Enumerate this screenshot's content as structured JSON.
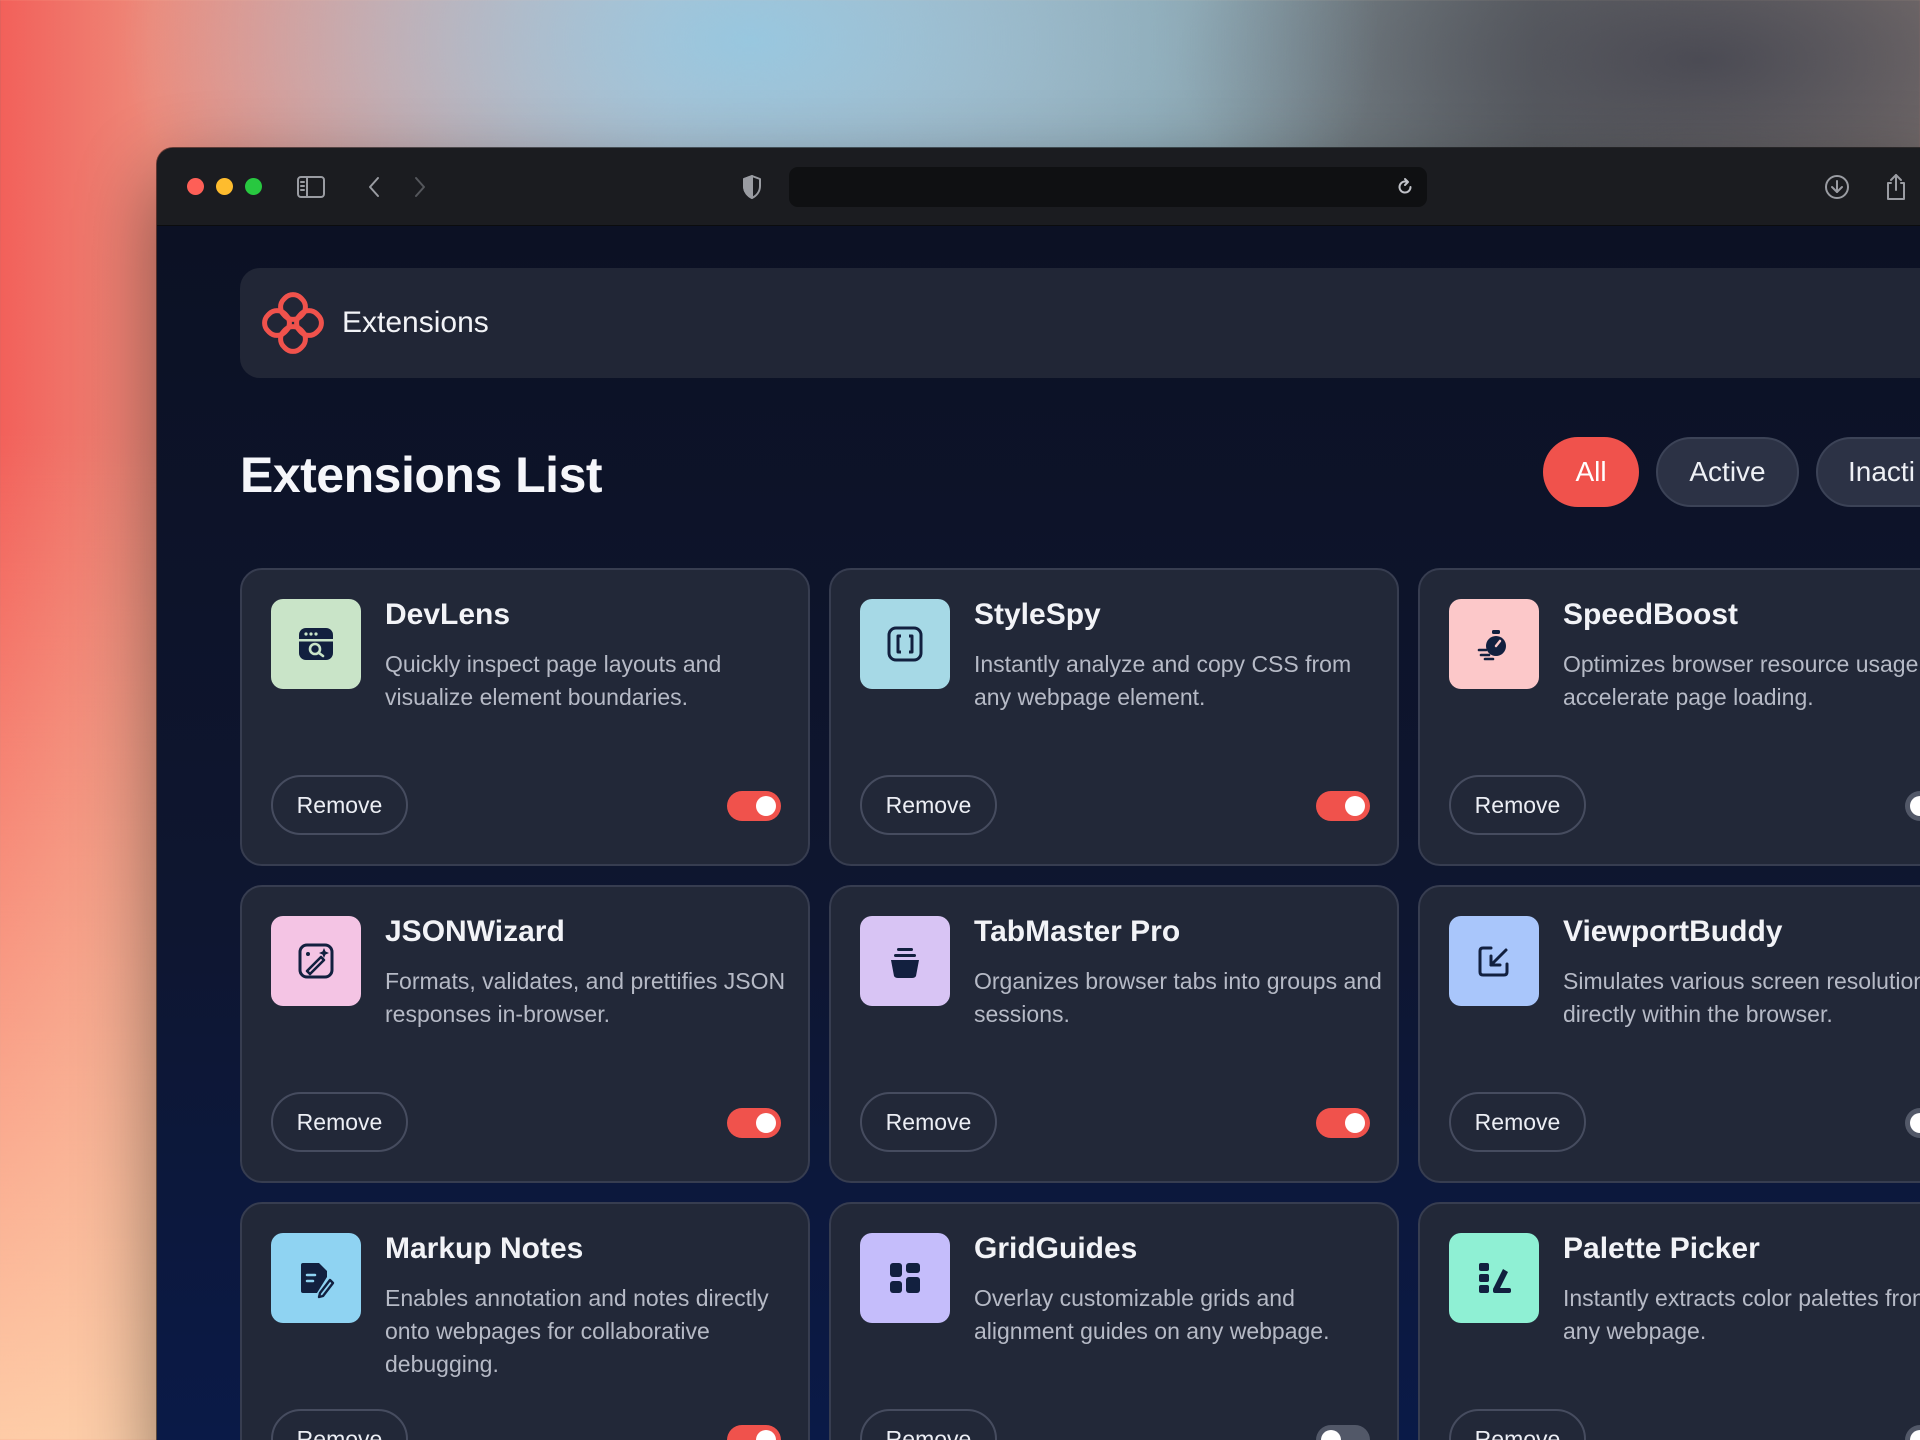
{
  "window": {
    "traffic_lights": [
      "close",
      "minimize",
      "maximize"
    ],
    "toolbar_icons": [
      "sidebar-icon",
      "back-icon",
      "forward-icon",
      "shield-icon",
      "reload-icon",
      "download-icon",
      "share-icon"
    ],
    "address": ""
  },
  "header": {
    "title": "Extensions",
    "logo_color": "#f0524c"
  },
  "main": {
    "title": "Extensions List",
    "filters": [
      {
        "label": "All",
        "selected": true
      },
      {
        "label": "Active",
        "selected": false
      },
      {
        "label": "Inacti",
        "selected": false
      }
    ]
  },
  "colors": {
    "accent": "#f0524c",
    "card_bg": "#222838",
    "page_bg": "#0e1630"
  },
  "extensions": [
    {
      "name": "DevLens",
      "description": "Quickly inspect page layouts and visualize element boundaries.",
      "remove_label": "Remove",
      "active": true,
      "icon": "browser-search-icon",
      "icon_bg": "#c9e4c8"
    },
    {
      "name": "StyleSpy",
      "description": "Instantly analyze and copy CSS from any webpage element.",
      "remove_label": "Remove",
      "active": true,
      "icon": "brackets-icon",
      "icon_bg": "#a6d9e6"
    },
    {
      "name": "SpeedBoost",
      "description": "Optimizes browser resource usage to accelerate page loading.",
      "remove_label": "Remove",
      "active": false,
      "icon": "stopwatch-icon",
      "icon_bg": "#fcc8c9"
    },
    {
      "name": "JSONWizard",
      "description": "Formats, validates, and prettifies JSON responses in-browser.",
      "remove_label": "Remove",
      "active": true,
      "icon": "wand-icon",
      "icon_bg": "#f4c4e4"
    },
    {
      "name": "TabMaster Pro",
      "description": "Organizes browser tabs into groups and sessions.",
      "remove_label": "Remove",
      "active": true,
      "icon": "stack-icon",
      "icon_bg": "#d8c4f4"
    },
    {
      "name": "ViewportBuddy",
      "description": "Simulates various screen resolutions directly within the browser.",
      "remove_label": "Remove",
      "active": false,
      "icon": "resize-icon",
      "icon_bg": "#a9c6fb"
    },
    {
      "name": "Markup Notes",
      "description": "Enables annotation and notes directly onto webpages for collaborative debugging.",
      "remove_label": "Remove",
      "active": true,
      "icon": "note-pen-icon",
      "icon_bg": "#8fd3f2"
    },
    {
      "name": "GridGuides",
      "description": "Overlay customizable grids and alignment guides on any webpage.",
      "remove_label": "Remove",
      "active": false,
      "icon": "grid-icon",
      "icon_bg": "#c5bdfb"
    },
    {
      "name": "Palette Picker",
      "description": "Instantly extracts color palettes from any webpage.",
      "remove_label": "Remove",
      "active": false,
      "icon": "palette-icon",
      "icon_bg": "#8ff0d4"
    }
  ]
}
